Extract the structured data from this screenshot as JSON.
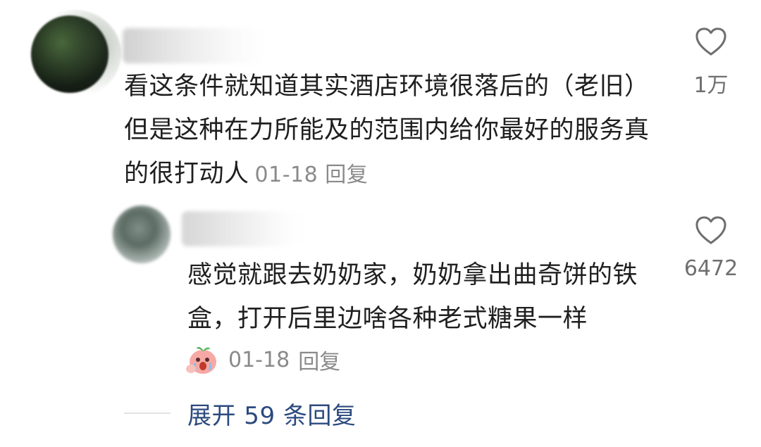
{
  "main_comment": {
    "text": "看这条件就知道其实酒店环境很落后的（老旧）但是这种在力所能及的范围内给你最好的服务真的很打动人",
    "date": "01-18",
    "reply_label": "回复",
    "likes": "1万"
  },
  "reply_comment": {
    "text": "感觉就跟去奶奶家，奶奶拿出曲奇饼的铁盒，打开后里边啥各种老式糖果一样",
    "date": "01-18",
    "reply_label": "回复",
    "likes": "6472",
    "sticker_icon": "crying-peach-sticker-icon"
  },
  "expand": {
    "label": "展开 59 条回复"
  },
  "colors": {
    "text": "#1f1f1f",
    "meta": "#8a8a8a",
    "link": "#2b4a7e"
  }
}
